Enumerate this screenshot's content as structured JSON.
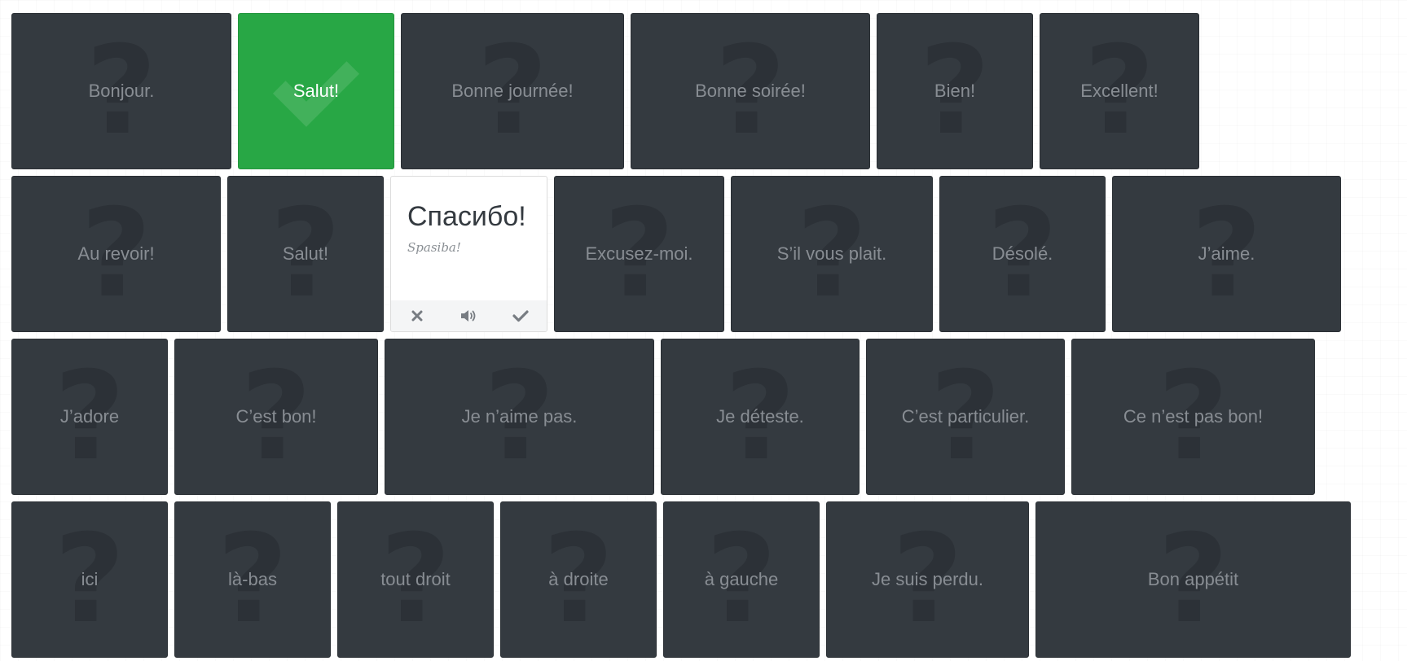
{
  "rows": [
    [
      {
        "label": "Bonjour.",
        "state": "hidden"
      },
      {
        "label": "Salut!",
        "state": "correct"
      },
      {
        "label": "Bonne journée!",
        "state": "hidden"
      },
      {
        "label": "Bonne soirée!",
        "state": "hidden"
      },
      {
        "label": "Bien!",
        "state": "hidden"
      },
      {
        "label": "Excellent!",
        "state": "hidden"
      }
    ],
    [
      {
        "label": "Au revoir!",
        "state": "hidden"
      },
      {
        "label": "Salut!",
        "state": "hidden"
      },
      {
        "state": "flipped",
        "word": "Спасибо!",
        "transliteration": "Spasiba!"
      },
      {
        "label": "Excusez-moi.",
        "state": "hidden"
      },
      {
        "label": "S’il vous plait.",
        "state": "hidden"
      },
      {
        "label": "Désolé.",
        "state": "hidden"
      },
      {
        "label": "J’aime.",
        "state": "hidden"
      }
    ],
    [
      {
        "label": "J’adore",
        "state": "hidden"
      },
      {
        "label": "C’est bon!",
        "state": "hidden"
      },
      {
        "label": "Je n’aime pas.",
        "state": "hidden"
      },
      {
        "label": "Je déteste.",
        "state": "hidden"
      },
      {
        "label": "C’est particulier.",
        "state": "hidden"
      },
      {
        "label": "Ce n’est pas bon!",
        "state": "hidden"
      }
    ],
    [
      {
        "label": "ici",
        "state": "hidden"
      },
      {
        "label": "là-bas",
        "state": "hidden"
      },
      {
        "label": "tout droit",
        "state": "hidden"
      },
      {
        "label": "à droite",
        "state": "hidden"
      },
      {
        "label": "à gauche",
        "state": "hidden"
      },
      {
        "label": "Je suis perdu.",
        "state": "hidden"
      },
      {
        "label": "Bon appétit",
        "state": "hidden"
      }
    ]
  ],
  "card_back_symbol": "?",
  "colors": {
    "card_background": "#343a40",
    "card_text": "#888d93",
    "correct_background": "#28a745",
    "flipped_background": "#ffffff"
  },
  "flipped_card_actions": [
    {
      "icon": "close-icon"
    },
    {
      "icon": "speaker-icon"
    },
    {
      "icon": "checkmark-icon"
    }
  ]
}
